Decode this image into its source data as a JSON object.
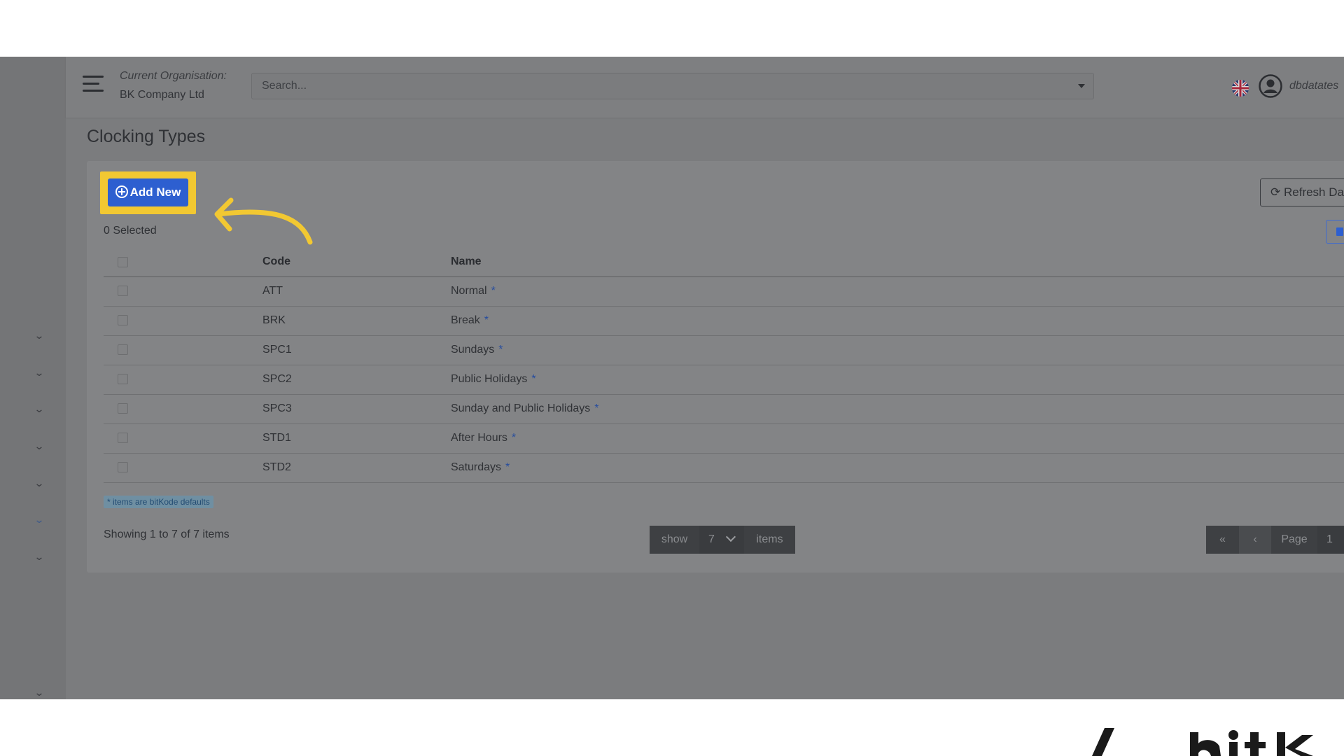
{
  "colors": {
    "accent": "#2d5fd0",
    "highlight": "#f2c832",
    "overlay": "#7b7c7e"
  },
  "header": {
    "menu_icon": "hamburger-icon",
    "org_label": "Current Organisation:",
    "org_name": "BK Company Ltd",
    "search_placeholder": "Search...",
    "language_icon": "uk-flag-icon",
    "user_icon": "user-circle-icon",
    "username": "dbdatates"
  },
  "sidebar": {
    "expanders": [
      "chevron-down-icon",
      "chevron-down-icon",
      "chevron-down-icon",
      "chevron-down-icon",
      "chevron-down-icon",
      "chevron-down-icon",
      "chevron-down-icon",
      "chevron-down-icon"
    ]
  },
  "page": {
    "title": "Clocking Types",
    "add_button_label": "Add New",
    "refresh_button_label": "Refresh Da",
    "selected_count": "0 Selected",
    "defaults_note": "* items are bitKode defaults",
    "showing": "Showing 1 to 7 of 7 items"
  },
  "table": {
    "columns": [
      "Code",
      "Name"
    ],
    "rows": [
      {
        "code": "ATT",
        "name": "Normal",
        "default_marker": "*"
      },
      {
        "code": "BRK",
        "name": "Break",
        "default_marker": "*"
      },
      {
        "code": "SPC1",
        "name": "Sundays",
        "default_marker": "*"
      },
      {
        "code": "SPC2",
        "name": "Public Holidays",
        "default_marker": "*"
      },
      {
        "code": "SPC3",
        "name": "Sunday and Public Holidays",
        "default_marker": "*"
      },
      {
        "code": "STD1",
        "name": "After Hours",
        "default_marker": "*"
      },
      {
        "code": "STD2",
        "name": "Saturdays",
        "default_marker": "*"
      }
    ]
  },
  "pagination": {
    "show_label": "show",
    "page_size": "7",
    "items_label": "items",
    "first_icon": "double-chevron-left-icon",
    "prev_icon": "chevron-left-icon",
    "page_label": "Page",
    "current_page": "1"
  },
  "branding": {
    "logo": "bitkode-logo"
  }
}
